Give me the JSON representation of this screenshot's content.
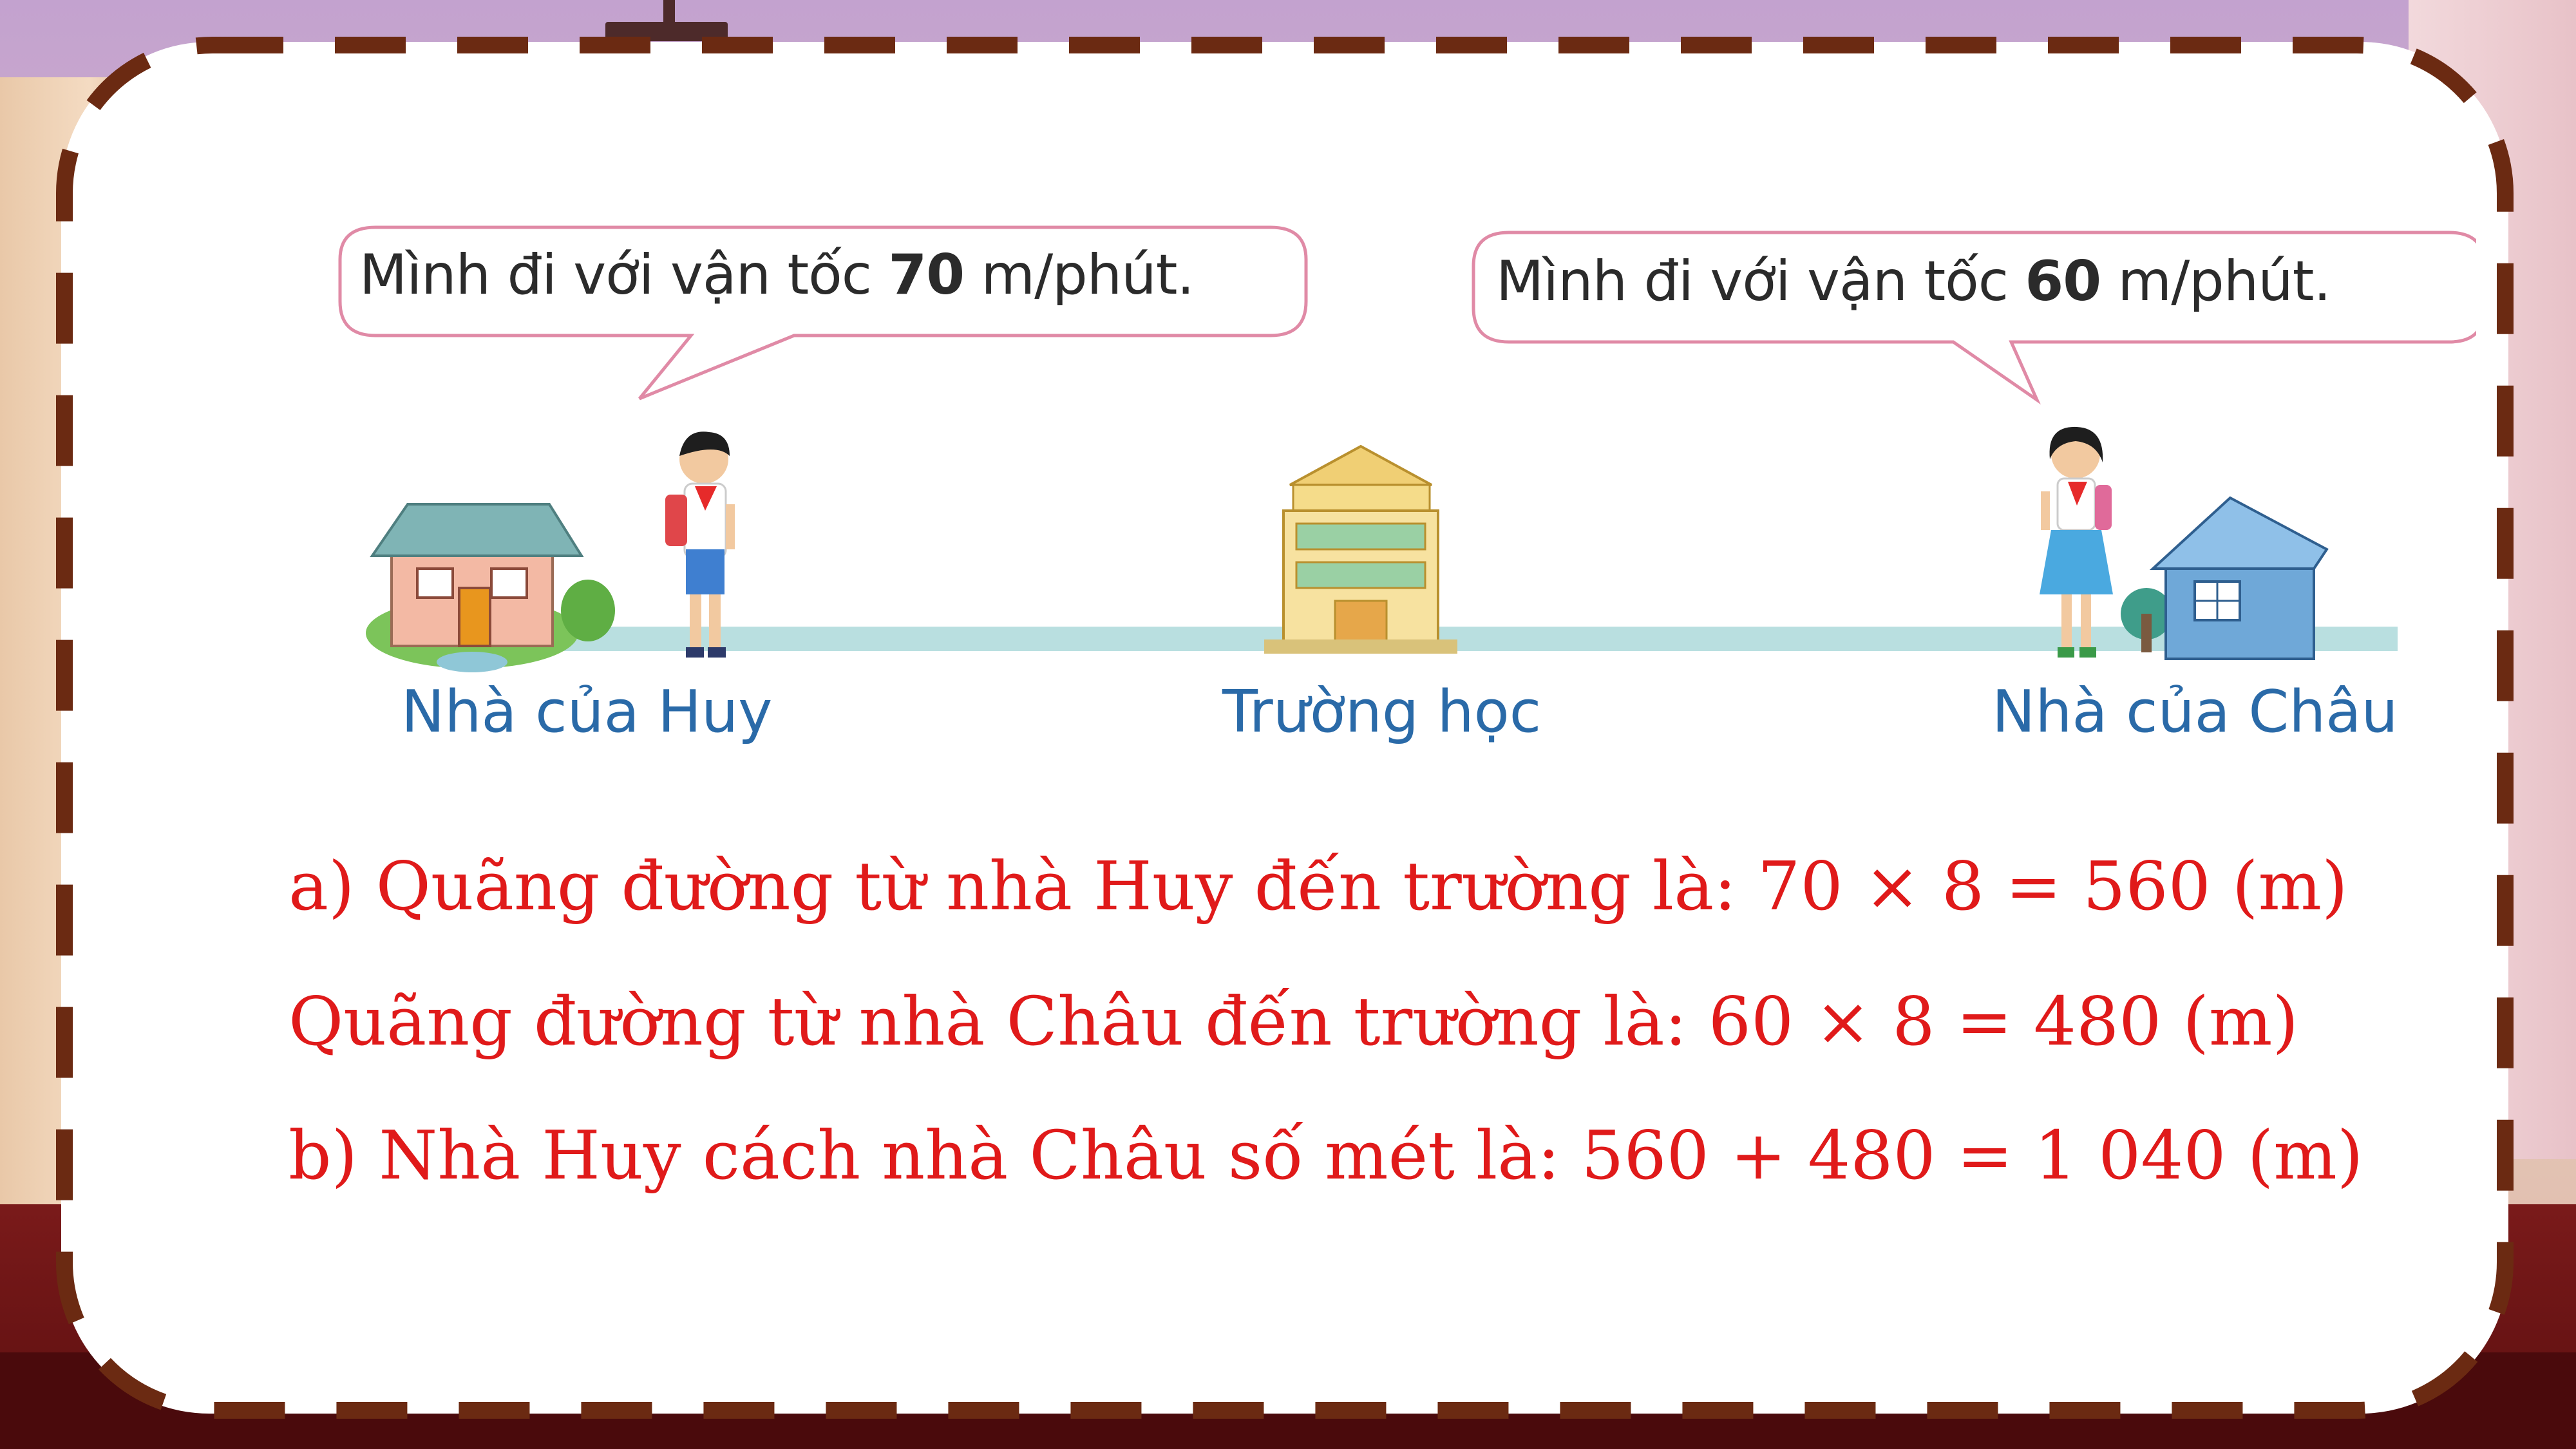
{
  "bubbles": {
    "huy": {
      "prefix": "Mình đi với vận tốc ",
      "speed": "70",
      "suffix": " m/phút."
    },
    "chau": {
      "prefix": "Mình đi với vận tốc ",
      "speed": "60",
      "suffix": " m/phút."
    }
  },
  "places": {
    "huy_home": "Nhà của Huy",
    "school": "Trường học",
    "chau_home": "Nhà của Châu"
  },
  "answers": {
    "line_a": "a) Quãng đường từ nhà Huy đến trường là: 70 × 8 = 560 (m)",
    "line_a2": "Quãng đường từ nhà Châu đến trường là: 60 × 8 = 480 (m)",
    "line_b": "b) Nhà Huy cách nhà Châu số mét là: 560 + 480 = 1 040 (m)"
  },
  "colors": {
    "answer_text": "#e01a1a",
    "label_text": "#2a6aa8",
    "border_dash": "#6b2a12",
    "road": "#b9dfe0"
  }
}
